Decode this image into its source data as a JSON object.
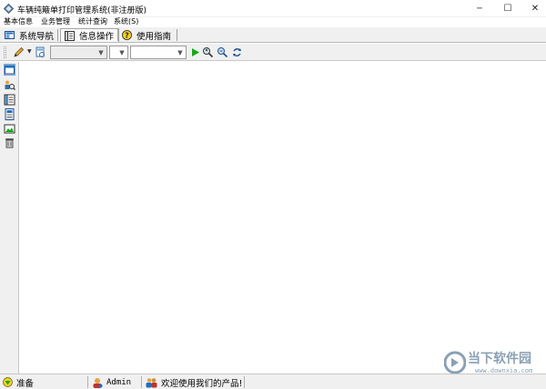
{
  "window": {
    "title": "车辆纯簸单打印管理系统(非注册版)",
    "minimize_glyph": "─",
    "maximize_glyph": "☐",
    "close_glyph": "✕"
  },
  "menu": {
    "items": [
      "基本信息",
      "业务管理",
      "统计查询",
      "系统(S)"
    ]
  },
  "tabs": {
    "items": [
      {
        "label": "系统导航",
        "icon": "navigation-icon"
      },
      {
        "label": "信息操作",
        "icon": "info-panel-icon"
      },
      {
        "label": "使用指南",
        "icon": "help-icon"
      }
    ],
    "active_index": 1
  },
  "toolbar": {
    "dropdowns": [
      {
        "value": "",
        "state": "disabled"
      },
      {
        "value": "",
        "state": "normal"
      },
      {
        "value": "",
        "state": "normal"
      }
    ],
    "icons": [
      "edit-pencil-icon",
      "document-view-icon",
      "run-icon",
      "search-user-icon",
      "zoom-search-icon",
      "refresh-icon"
    ]
  },
  "sidebar": {
    "icons": [
      "window-icon",
      "search-users-icon",
      "list-icon",
      "document-icon",
      "image-icon",
      "delete-bin-icon"
    ]
  },
  "statusbar": {
    "status": "准备",
    "user": "Admin",
    "message": "欢迎使用我们的产品!"
  },
  "watermark": {
    "text": "当下软件园",
    "url": "www.downxia.com"
  },
  "colors": {
    "chrome": "#f0f0f0",
    "active_tab": "#fafafa",
    "accent_blue": "#1f6fbf",
    "run_green": "#18a818",
    "watermark": "#8aa0b4"
  }
}
